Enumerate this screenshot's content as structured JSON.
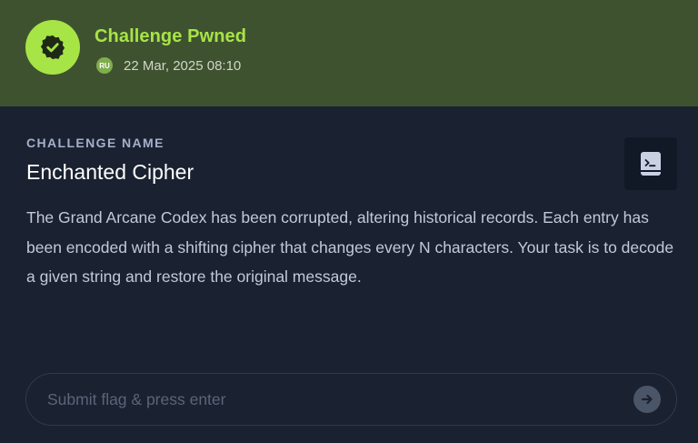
{
  "banner": {
    "title": "Challenge Pwned",
    "user_initials": "RU",
    "date": "22 Mar, 2025 08:10",
    "accent_color": "#a7e446",
    "badge_icon": "verified-check-badge-icon"
  },
  "challenge": {
    "label": "CHALLENGE NAME",
    "name": "Enchanted Cipher",
    "description": "The Grand Arcane Codex has been corrupted, altering historical records. Each entry has been encoded with a shifting cipher that changes every N characters. Your task is to decode a given string and restore the original message.",
    "action_icon": "terminal-file-icon"
  },
  "flag_input": {
    "value": "",
    "placeholder": "Submit flag & press enter",
    "submit_icon": "arrow-right-icon"
  }
}
